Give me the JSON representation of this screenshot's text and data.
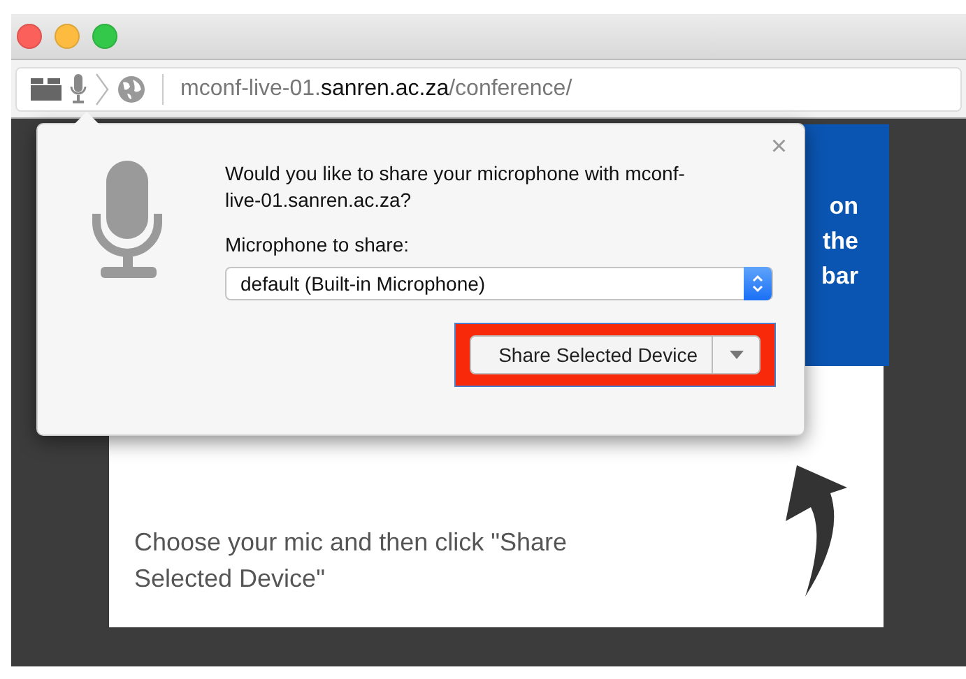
{
  "window": {
    "traffic_lights": [
      {
        "color": "#fc605b"
      },
      {
        "color": "#fdbc40"
      },
      {
        "color": "#34c84a"
      }
    ]
  },
  "address_bar": {
    "url_host_prefix": "mconf-live-01.",
    "url_domain": "sanren.ac.za",
    "url_path": "/conference/"
  },
  "page": {
    "banner_lines": [
      "on",
      "the",
      "bar"
    ],
    "instruction": "Choose your mic and then click \"Share Selected Device\""
  },
  "popup": {
    "close_glyph": "×",
    "question": "Would you like to share your microphone with mconf-live-01.sanren.ac.za?",
    "device_label": "Microphone to share:",
    "device_value": "default (Built-in Microphone)",
    "share_button": "Share Selected Device",
    "highlighted": true
  }
}
